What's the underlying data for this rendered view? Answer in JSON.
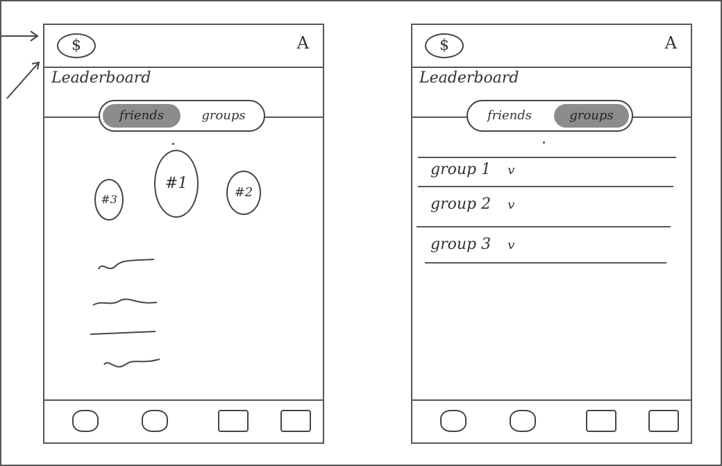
{
  "screens": [
    {
      "title": "Leaderboard",
      "header": {
        "left_icon": "$",
        "right_icon": "A"
      },
      "tabs": [
        {
          "label": "friends",
          "active": true
        },
        {
          "label": "groups",
          "active": false
        }
      ],
      "podium": [
        "#3",
        "#1",
        "#2"
      ]
    },
    {
      "title": "Leaderboard",
      "header": {
        "left_icon": "$",
        "right_icon": "A"
      },
      "tabs": [
        {
          "label": "friends",
          "active": false
        },
        {
          "label": "groups",
          "active": true
        }
      ],
      "groups": [
        {
          "label": "group 1",
          "chevron": "v"
        },
        {
          "label": "group 2",
          "chevron": "v"
        },
        {
          "label": "group 3",
          "chevron": "v"
        }
      ]
    }
  ],
  "colors": {
    "ink": "#444444",
    "highlight": "#8c8c8c"
  }
}
